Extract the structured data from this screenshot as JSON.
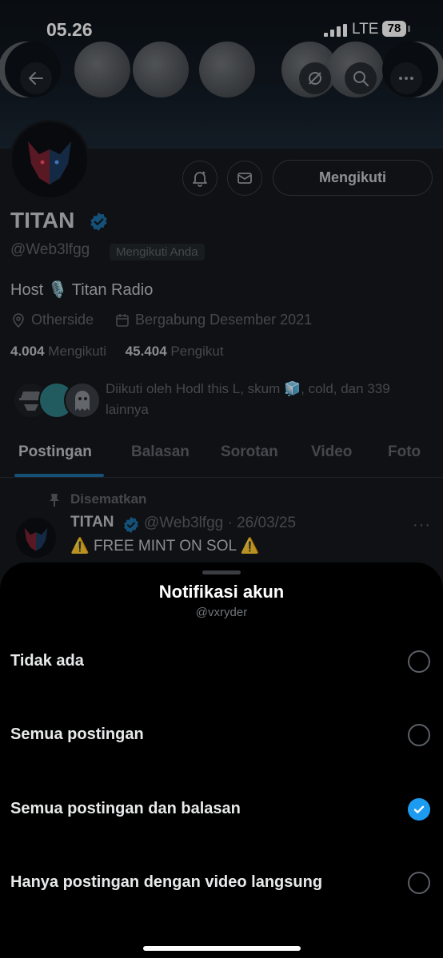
{
  "status_bar": {
    "time": "05.26",
    "network": "LTE",
    "battery": "78"
  },
  "profile": {
    "name": "TITAN",
    "handle": "@Web3lfgg",
    "follows_you": "Mengikuti Anda",
    "bio": "Host 🎙️ Titan Radio",
    "location": "Otherside",
    "joined": "Bergabung Desember 2021",
    "following_count": "4.004",
    "following_label": "Mengikuti",
    "followers_count": "45.404",
    "followers_label": "Pengikut",
    "followed_by": "Diikuti oleh Hodl this L, skum 🧊, cold, dan 339 lainnya",
    "follow_button": "Mengikuti"
  },
  "tabs": [
    {
      "label": "Postingan",
      "active": true
    },
    {
      "label": "Balasan"
    },
    {
      "label": "Sorotan"
    },
    {
      "label": "Video"
    },
    {
      "label": "Foto"
    }
  ],
  "pinned_post": {
    "pinned_label": "Disematkan",
    "name": "TITAN",
    "meta": "@Web3lfgg · 26/03/25",
    "text": " FREE MINT ON SOL "
  },
  "sheet": {
    "title": "Notifikasi akun",
    "subtitle": "@vxryder",
    "options": [
      {
        "label": "Tidak ada",
        "selected": false
      },
      {
        "label": "Semua postingan",
        "selected": false
      },
      {
        "label": "Semua postingan dan balasan",
        "selected": true
      },
      {
        "label": "Hanya postingan dengan video langsung",
        "selected": false
      }
    ]
  },
  "colors": {
    "accent": "#1d9bf0",
    "sheet_bg": "#000000",
    "page_bg": "#15181c"
  },
  "icons": [
    "back-arrow-icon",
    "no-location-icon",
    "search-icon",
    "more-icon",
    "bell-icon",
    "mail-icon",
    "verified-icon",
    "location-icon",
    "calendar-icon",
    "pin-icon",
    "check-icon"
  ]
}
